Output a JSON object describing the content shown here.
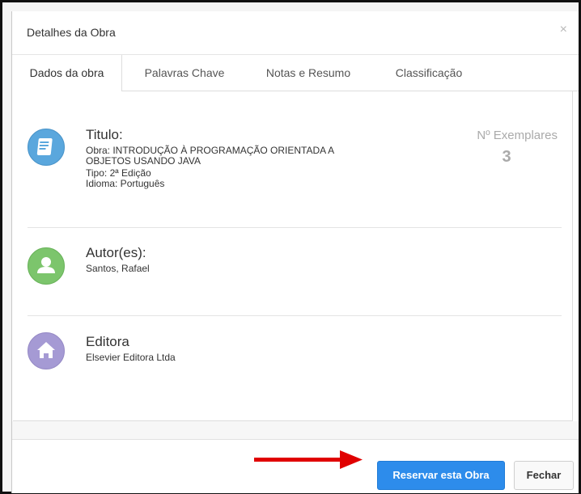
{
  "modal": {
    "title": "Detalhes da Obra",
    "close_glyph": "×"
  },
  "tabs": [
    {
      "label": "Dados da obra",
      "active": true
    },
    {
      "label": "Palavras Chave",
      "active": false
    },
    {
      "label": "Notas e Resumo",
      "active": false
    },
    {
      "label": "Classificação",
      "active": false
    }
  ],
  "titulo": {
    "heading": "Titulo:",
    "obra_line1": "Obra: INTRODUÇÃO À PROGRAMAÇÃO ORIENTADA A",
    "obra_line2": "OBJETOS USANDO JAVA",
    "tipo": "Tipo: 2ª Edição",
    "idioma": "Idioma: Português",
    "icon": "book-icon",
    "icon_color": "#5aa7dd"
  },
  "exemplares": {
    "label": "Nº Exemplares",
    "value": "3"
  },
  "autor": {
    "heading": "Autor(es):",
    "name": "Santos, Rafael",
    "icon": "user-icon",
    "icon_color": "#7cc56c"
  },
  "editora": {
    "heading": "Editora",
    "name": "Elsevier Editora Ltda",
    "icon": "home-icon",
    "icon_color": "#a59ad4"
  },
  "footer": {
    "reserve_label": "Reservar esta Obra",
    "close_label": "Fechar",
    "primary_color": "#2d8ceb",
    "arrow_color": "#e00000"
  }
}
